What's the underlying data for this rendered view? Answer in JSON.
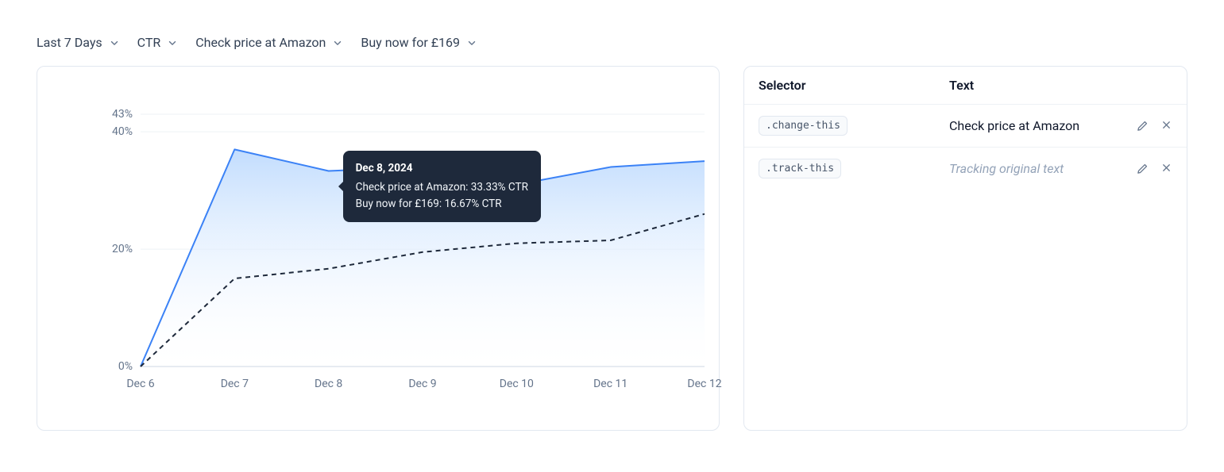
{
  "filters": {
    "range": "Last 7 Days",
    "metric": "CTR",
    "variant_a": "Check price at Amazon",
    "variant_b": "Buy now for £169"
  },
  "chart_data": {
    "type": "line",
    "title": "",
    "xlabel": "",
    "ylabel": "",
    "x_labels": [
      "Dec 6",
      "Dec 7",
      "Dec 8",
      "Dec 9",
      "Dec 10",
      "Dec 11",
      "Dec 12"
    ],
    "y_ticks": [
      0,
      20,
      40,
      43
    ],
    "ylim": [
      0,
      43
    ],
    "area_fill_series": "Check price at Amazon",
    "series": [
      {
        "name": "Check price at Amazon",
        "style": "solid-area",
        "color": "#3b82f6",
        "values": [
          0,
          37,
          33.33,
          34,
          31,
          34,
          35
        ]
      },
      {
        "name": "Buy now for £169",
        "style": "dashed",
        "color": "#1e293b",
        "values": [
          0,
          15,
          16.67,
          19.5,
          21,
          21.5,
          26
        ]
      }
    ]
  },
  "tooltip": {
    "title": "Dec 8, 2024",
    "lines": [
      "Check price at Amazon: 33.33% CTR",
      "Buy now for £169: 16.67% CTR"
    ],
    "x_index": 2
  },
  "table": {
    "head": {
      "selector": "Selector",
      "text": "Text"
    },
    "rows": [
      {
        "selector": ".change-this",
        "text": "Check price at Amazon",
        "placeholder": false
      },
      {
        "selector": ".track-this",
        "text": "Tracking original text",
        "placeholder": true
      }
    ]
  }
}
